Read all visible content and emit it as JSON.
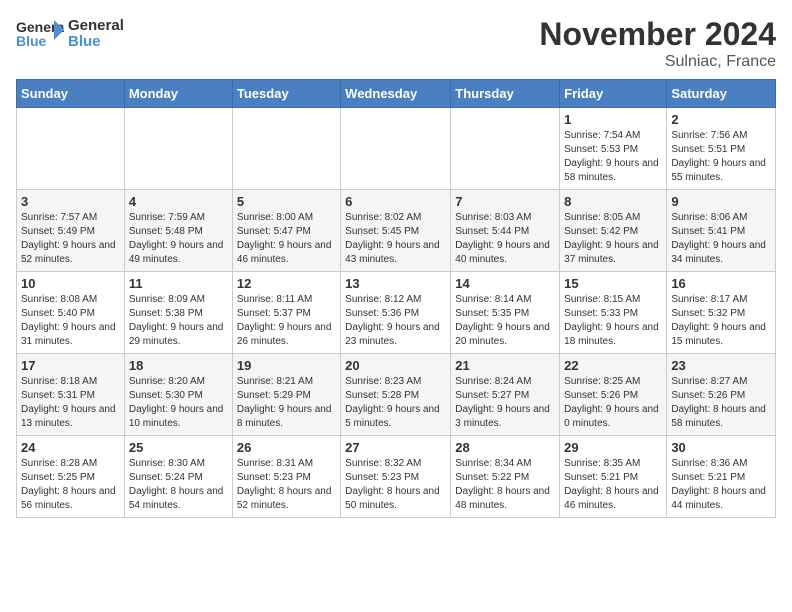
{
  "header": {
    "logo_line1": "General",
    "logo_line2": "Blue",
    "title": "November 2024",
    "subtitle": "Sulniac, France"
  },
  "days_of_week": [
    "Sunday",
    "Monday",
    "Tuesday",
    "Wednesday",
    "Thursday",
    "Friday",
    "Saturday"
  ],
  "weeks": [
    [
      {
        "day": "",
        "info": ""
      },
      {
        "day": "",
        "info": ""
      },
      {
        "day": "",
        "info": ""
      },
      {
        "day": "",
        "info": ""
      },
      {
        "day": "",
        "info": ""
      },
      {
        "day": "1",
        "info": "Sunrise: 7:54 AM\nSunset: 5:53 PM\nDaylight: 9 hours and 58 minutes."
      },
      {
        "day": "2",
        "info": "Sunrise: 7:56 AM\nSunset: 5:51 PM\nDaylight: 9 hours and 55 minutes."
      }
    ],
    [
      {
        "day": "3",
        "info": "Sunrise: 7:57 AM\nSunset: 5:49 PM\nDaylight: 9 hours and 52 minutes."
      },
      {
        "day": "4",
        "info": "Sunrise: 7:59 AM\nSunset: 5:48 PM\nDaylight: 9 hours and 49 minutes."
      },
      {
        "day": "5",
        "info": "Sunrise: 8:00 AM\nSunset: 5:47 PM\nDaylight: 9 hours and 46 minutes."
      },
      {
        "day": "6",
        "info": "Sunrise: 8:02 AM\nSunset: 5:45 PM\nDaylight: 9 hours and 43 minutes."
      },
      {
        "day": "7",
        "info": "Sunrise: 8:03 AM\nSunset: 5:44 PM\nDaylight: 9 hours and 40 minutes."
      },
      {
        "day": "8",
        "info": "Sunrise: 8:05 AM\nSunset: 5:42 PM\nDaylight: 9 hours and 37 minutes."
      },
      {
        "day": "9",
        "info": "Sunrise: 8:06 AM\nSunset: 5:41 PM\nDaylight: 9 hours and 34 minutes."
      }
    ],
    [
      {
        "day": "10",
        "info": "Sunrise: 8:08 AM\nSunset: 5:40 PM\nDaylight: 9 hours and 31 minutes."
      },
      {
        "day": "11",
        "info": "Sunrise: 8:09 AM\nSunset: 5:38 PM\nDaylight: 9 hours and 29 minutes."
      },
      {
        "day": "12",
        "info": "Sunrise: 8:11 AM\nSunset: 5:37 PM\nDaylight: 9 hours and 26 minutes."
      },
      {
        "day": "13",
        "info": "Sunrise: 8:12 AM\nSunset: 5:36 PM\nDaylight: 9 hours and 23 minutes."
      },
      {
        "day": "14",
        "info": "Sunrise: 8:14 AM\nSunset: 5:35 PM\nDaylight: 9 hours and 20 minutes."
      },
      {
        "day": "15",
        "info": "Sunrise: 8:15 AM\nSunset: 5:33 PM\nDaylight: 9 hours and 18 minutes."
      },
      {
        "day": "16",
        "info": "Sunrise: 8:17 AM\nSunset: 5:32 PM\nDaylight: 9 hours and 15 minutes."
      }
    ],
    [
      {
        "day": "17",
        "info": "Sunrise: 8:18 AM\nSunset: 5:31 PM\nDaylight: 9 hours and 13 minutes."
      },
      {
        "day": "18",
        "info": "Sunrise: 8:20 AM\nSunset: 5:30 PM\nDaylight: 9 hours and 10 minutes."
      },
      {
        "day": "19",
        "info": "Sunrise: 8:21 AM\nSunset: 5:29 PM\nDaylight: 9 hours and 8 minutes."
      },
      {
        "day": "20",
        "info": "Sunrise: 8:23 AM\nSunset: 5:28 PM\nDaylight: 9 hours and 5 minutes."
      },
      {
        "day": "21",
        "info": "Sunrise: 8:24 AM\nSunset: 5:27 PM\nDaylight: 9 hours and 3 minutes."
      },
      {
        "day": "22",
        "info": "Sunrise: 8:25 AM\nSunset: 5:26 PM\nDaylight: 9 hours and 0 minutes."
      },
      {
        "day": "23",
        "info": "Sunrise: 8:27 AM\nSunset: 5:26 PM\nDaylight: 8 hours and 58 minutes."
      }
    ],
    [
      {
        "day": "24",
        "info": "Sunrise: 8:28 AM\nSunset: 5:25 PM\nDaylight: 8 hours and 56 minutes."
      },
      {
        "day": "25",
        "info": "Sunrise: 8:30 AM\nSunset: 5:24 PM\nDaylight: 8 hours and 54 minutes."
      },
      {
        "day": "26",
        "info": "Sunrise: 8:31 AM\nSunset: 5:23 PM\nDaylight: 8 hours and 52 minutes."
      },
      {
        "day": "27",
        "info": "Sunrise: 8:32 AM\nSunset: 5:23 PM\nDaylight: 8 hours and 50 minutes."
      },
      {
        "day": "28",
        "info": "Sunrise: 8:34 AM\nSunset: 5:22 PM\nDaylight: 8 hours and 48 minutes."
      },
      {
        "day": "29",
        "info": "Sunrise: 8:35 AM\nSunset: 5:21 PM\nDaylight: 8 hours and 46 minutes."
      },
      {
        "day": "30",
        "info": "Sunrise: 8:36 AM\nSunset: 5:21 PM\nDaylight: 8 hours and 44 minutes."
      }
    ]
  ]
}
